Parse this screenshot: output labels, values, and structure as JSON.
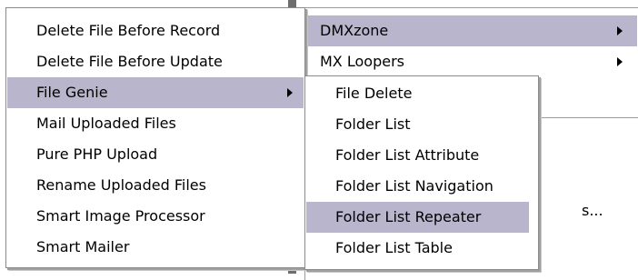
{
  "left_menu": {
    "items": [
      {
        "label": "Delete File Before Record"
      },
      {
        "label": "Delete File Before Update"
      },
      {
        "label": "File Genie"
      },
      {
        "label": "Mail Uploaded Files"
      },
      {
        "label": "Pure PHP Upload"
      },
      {
        "label": "Rename Uploaded Files"
      },
      {
        "label": "Smart Image Processor"
      },
      {
        "label": "Smart Mailer"
      }
    ]
  },
  "right_menu": {
    "items": [
      {
        "label": "DMXzone"
      },
      {
        "label": "MX Loopers"
      }
    ],
    "hidden_tail": "s..."
  },
  "sub_menu": {
    "items": [
      {
        "label": "File Delete"
      },
      {
        "label": "Folder List"
      },
      {
        "label": "Folder List Attribute"
      },
      {
        "label": "Folder List Navigation"
      },
      {
        "label": "Folder List Repeater"
      },
      {
        "label": "Folder List Table"
      }
    ]
  },
  "colors": {
    "highlight": "#b8b5cc"
  }
}
